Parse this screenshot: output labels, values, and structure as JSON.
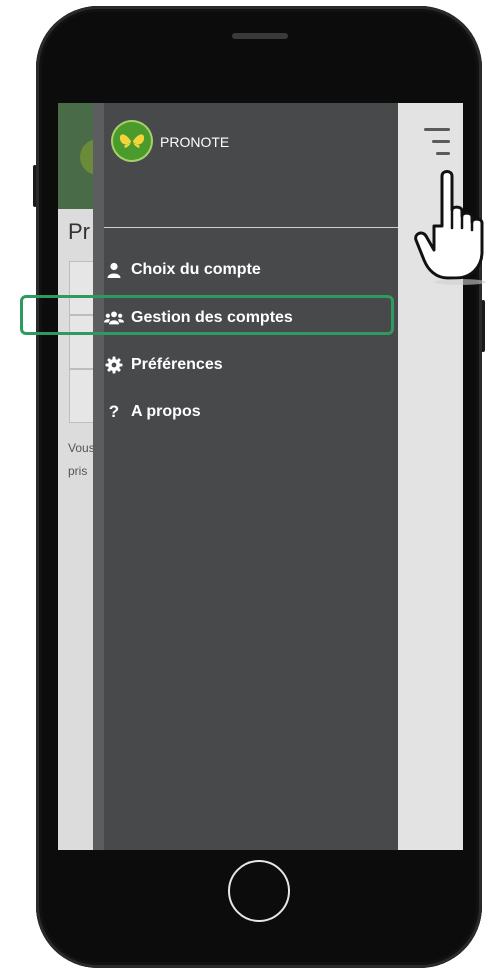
{
  "app": {
    "name": "PRONOTE"
  },
  "background_page": {
    "title_fragment": "Pr",
    "text_line1": "Vous",
    "text_line2": "pris"
  },
  "menu": {
    "items": [
      {
        "label": "Choix du compte",
        "icon": "user-icon"
      },
      {
        "label": "Gestion des comptes",
        "icon": "users-icon"
      },
      {
        "label": "Préférences",
        "icon": "gear-icon"
      },
      {
        "label": "A propos",
        "icon": "question-icon"
      }
    ]
  },
  "colors": {
    "drawer_bg": "#47494b",
    "highlight": "#2e9a62",
    "logo_green": "#4b9a2c"
  }
}
